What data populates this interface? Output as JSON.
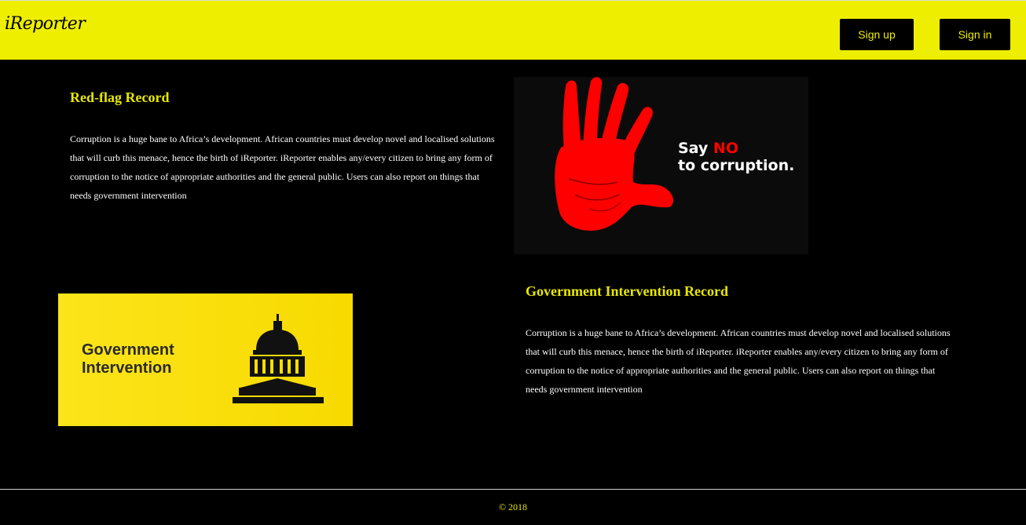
{
  "header": {
    "logo": "iReporter",
    "signup_label": "Sign up",
    "signin_label": "Sign in"
  },
  "cards": [
    {
      "title": "Red-flag Record",
      "text": "Corruption is a huge bane to Africa’s development. African countries must develop novel and localised solutions that will curb this menace, hence the birth of iReporter. iReporter enables any/every citizen to bring any form of corruption to the notice of appropriate authorities and the general public. Users can also report on things that needs government intervention",
      "image": {
        "line1_a": "Say ",
        "line1_b": "NO",
        "line2": "to corruption."
      }
    },
    {
      "title": "Government Intervention Record",
      "text": "Corruption is a huge bane to Africa’s development. African countries must develop novel and localised solutions that will curb this menace, hence the birth of iReporter. iReporter enables any/every citizen to bring any form of corruption to the notice of appropriate authorities and the general public. Users can also report on things that needs government intervention",
      "image": {
        "line1": "Government",
        "line2": "Intervention"
      }
    }
  ],
  "colors": {
    "accent": "#eeee00",
    "background": "#000000",
    "hand": "#ff0000"
  },
  "icons": [
    "red-hand-icon",
    "capitol-dome-icon"
  ],
  "footer": {
    "copyright": "© 2018"
  }
}
